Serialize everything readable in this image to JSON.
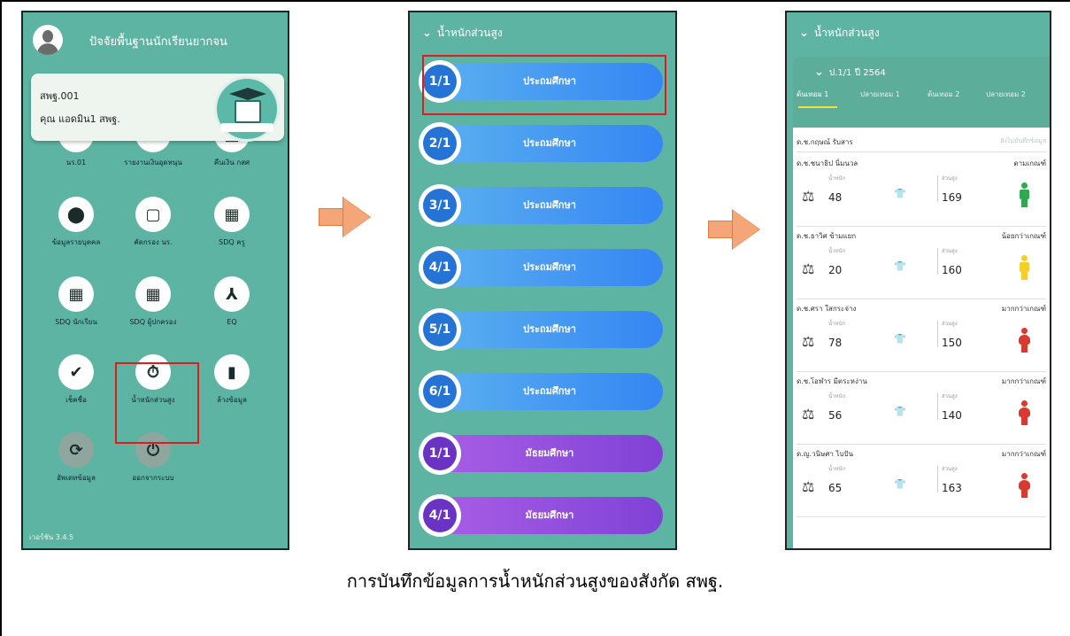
{
  "screen1": {
    "title": "ปัจจัยพื้นฐานนักเรียนยากจน",
    "user": {
      "code": "สพฐ.001",
      "name": "คุณ แอดมิน1 สพฐ."
    },
    "menu": [
      {
        "label": "นร.01",
        "icon": "shield-icon",
        "glyph": "✓"
      },
      {
        "label": "รายงานเงินอุดหนุน",
        "icon": "report-icon",
        "glyph": "▭"
      },
      {
        "label": "คืนเงิน กสศ",
        "icon": "money-icon",
        "glyph": "▤"
      },
      {
        "label": "ข้อมูลรายบุคคล",
        "icon": "location-icon",
        "glyph": "⬤"
      },
      {
        "label": "คัดกรอง นร.",
        "icon": "clipboard-icon",
        "glyph": "▢"
      },
      {
        "label": "SDQ ครู",
        "icon": "dashboard-icon",
        "glyph": "▦"
      },
      {
        "label": "SDQ นักเรียน",
        "icon": "dashboard-plus-icon",
        "glyph": "▦"
      },
      {
        "label": "SDQ ผู้ปกครอง",
        "icon": "dashboard-plus-icon",
        "glyph": "▦"
      },
      {
        "label": "EQ",
        "icon": "network-icon",
        "glyph": "⅄"
      },
      {
        "label": "เช็คชื่อ",
        "icon": "double-check-icon",
        "glyph": "✔"
      },
      {
        "label": "น้ำหนักส่วนสูง",
        "icon": "stopwatch-icon",
        "glyph": "⏱"
      },
      {
        "label": "ล้างข้อมูล",
        "icon": "trash-icon",
        "glyph": "▮"
      },
      {
        "label": "อัพเดทข้อมูล",
        "icon": "sync-icon",
        "glyph": "⟳"
      },
      {
        "label": "ออกจากระบบ",
        "icon": "power-icon",
        "glyph": "⏻"
      }
    ],
    "version": "เวอร์ชัน 3.4.5"
  },
  "screen2": {
    "header": "น้ำหนักส่วนสูง",
    "classes": [
      {
        "grade": "1/1",
        "level": "ประถมศึกษา",
        "kind": "primary"
      },
      {
        "grade": "2/1",
        "level": "ประถมศึกษา",
        "kind": "primary"
      },
      {
        "grade": "3/1",
        "level": "ประถมศึกษา",
        "kind": "primary"
      },
      {
        "grade": "4/1",
        "level": "ประถมศึกษา",
        "kind": "primary"
      },
      {
        "grade": "5/1",
        "level": "ประถมศึกษา",
        "kind": "primary"
      },
      {
        "grade": "6/1",
        "level": "ประถมศึกษา",
        "kind": "primary"
      },
      {
        "grade": "1/1",
        "level": "มัธยมศึกษา",
        "kind": "secondary"
      },
      {
        "grade": "4/1",
        "level": "มัธยมศึกษา",
        "kind": "secondary"
      }
    ]
  },
  "screen3": {
    "header": "น้ำหนักส่วนสูง",
    "year": "ป.1/1 ปี 2564",
    "tabs": [
      "ต้นเทอม 1",
      "ปลายเทอม 1",
      "ต้นเทอม 2",
      "ปลายเทอม 2"
    ],
    "list_head": {
      "name": "ด.ช.กฤษณ์ รับสาร",
      "status": "ยังไม่บันทึกข้อมูล"
    },
    "weight_label": "น้ำหนัก",
    "height_label": "ส่วนสูง",
    "students": [
      {
        "name": "ด.ช.ชนาธิป นิ่มนวล",
        "status": "ตามเกณฑ์",
        "weight": "48",
        "height": "169",
        "color": "#2fa84f"
      },
      {
        "name": "ด.ช.ธาวิศ ข้ามแยก",
        "status": "น้อยกว่าเกณฑ์",
        "weight": "20",
        "height": "160",
        "color": "#f2cf2a"
      },
      {
        "name": "ด.ช.ศรา ใสกระจ่าง",
        "status": "มากกว่าเกณฑ์",
        "weight": "78",
        "height": "150",
        "color": "#d93a2f"
      },
      {
        "name": "ด.ช.โอฬาร มีตระหง่าน",
        "status": "มากกว่าเกณฑ์",
        "weight": "56",
        "height": "140",
        "color": "#d93a2f"
      },
      {
        "name": "ด.ญ.วนิษศา ไบปัน",
        "status": "มากกว่าเกณฑ์",
        "weight": "65",
        "height": "163",
        "color": "#d93a2f"
      }
    ]
  },
  "caption": "การบันทึกข้อมูลการน้ำหนักส่วนสูงของสังกัด สพฐ."
}
